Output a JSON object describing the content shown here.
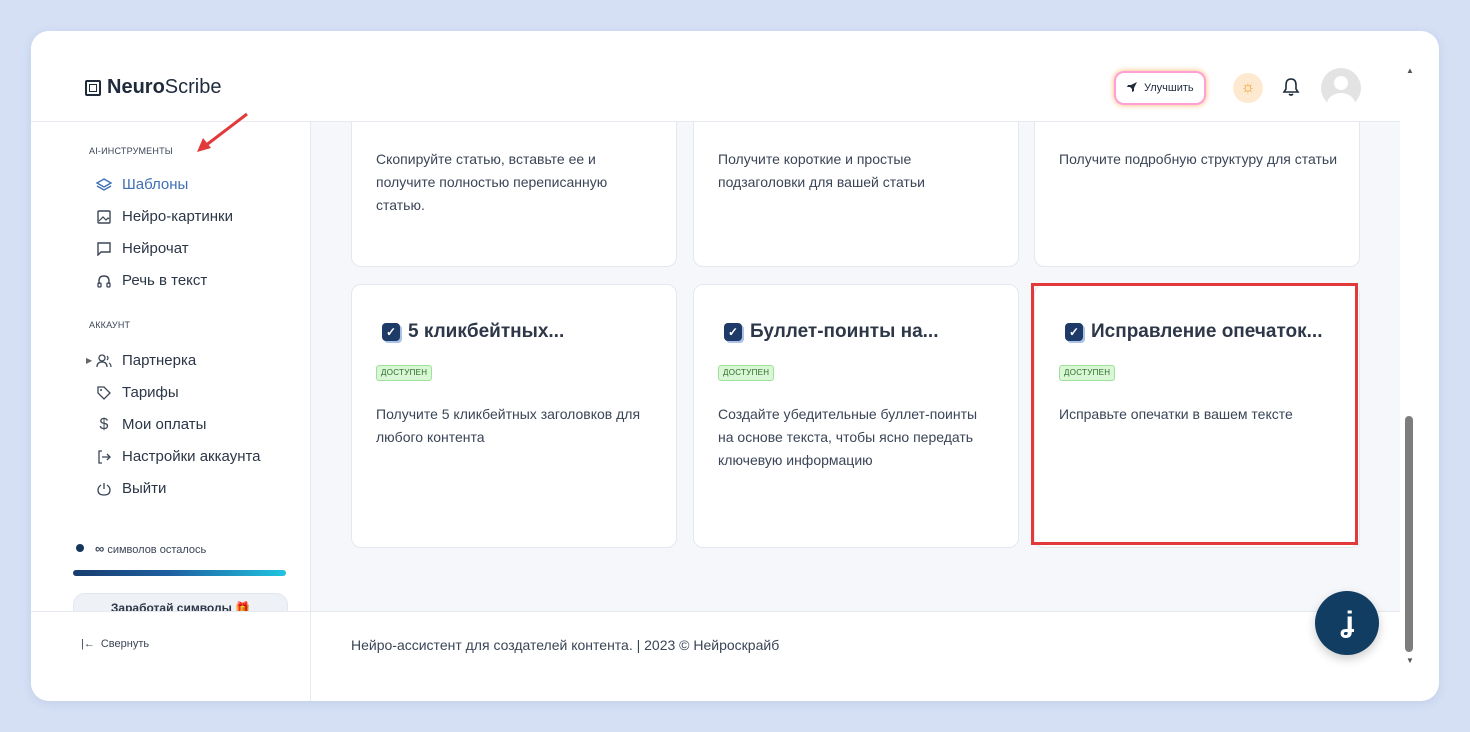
{
  "app": {
    "logo_bold": "Neuro",
    "logo_light": "Scribe"
  },
  "header": {
    "upgrade_label": "Улучшить"
  },
  "sidebar": {
    "section_ai": "AI-ИНСТРУМЕНТЫ",
    "ai_items": [
      {
        "label": "Шаблоны",
        "icon": "layers-icon"
      },
      {
        "label": "Нейро-картинки",
        "icon": "image-icon"
      },
      {
        "label": "Нейрочат",
        "icon": "chat-icon"
      },
      {
        "label": "Речь в текст",
        "icon": "headphones-icon"
      }
    ],
    "section_account": "АККАУНТ",
    "account_items": [
      {
        "label": "Партнерка",
        "icon": "users-icon"
      },
      {
        "label": "Тарифы",
        "icon": "tag-icon"
      },
      {
        "label": "Мои оплаты",
        "icon": "dollar-icon"
      },
      {
        "label": "Настройки аккаунта",
        "icon": "login-icon"
      },
      {
        "label": "Выйти",
        "icon": "power-icon"
      }
    ],
    "symbols_infinity": "∞",
    "symbols_text": "символов осталось",
    "symbols_fill": 1.0,
    "earn_label": "Заработай символы 🎁",
    "collapse_label": "Свернуть"
  },
  "cards_top": [
    {
      "desc": "Скопируйте статью, вставьте ее и получите полностью переписанную статью."
    },
    {
      "desc": "Получите короткие и простые подзаголовки для вашей статьи"
    },
    {
      "desc": "Получите подробную структуру для статьи"
    }
  ],
  "cards": [
    {
      "title": "5 кликбейтных...",
      "badge": "ДОСТУПЕН",
      "desc": "Получите 5 кликбейтных заголовков для любого контента"
    },
    {
      "title": "Буллет-поинты на...",
      "badge": "ДОСТУПЕН",
      "desc": "Создайте убедительные буллет-поинты на основе текста, чтобы ясно передать ключевую информацию"
    },
    {
      "title": "Исправление опечаток...",
      "badge": "ДОСТУПЕН",
      "desc": "Исправьте опечатки в вашем тексте"
    }
  ],
  "footer": {
    "text": "Нейро-ассистент для создателей контента.  | 2023 © Нейроскрайб"
  },
  "colors": {
    "accent": "#3f6fb6",
    "highlight": "#e23a3a",
    "badge_bg": "#d9f6d5",
    "navy": "#123d63"
  }
}
